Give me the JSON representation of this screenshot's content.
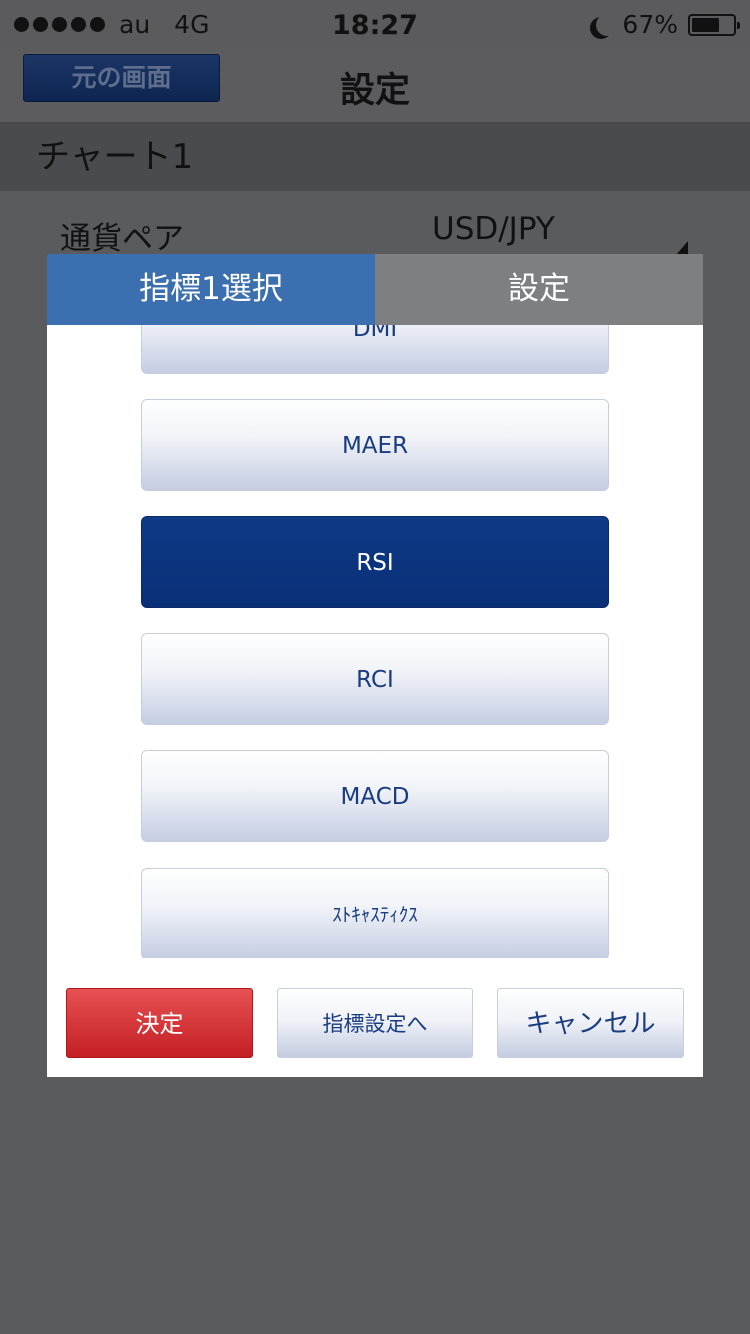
{
  "status": {
    "carrier": "au",
    "network": "4G",
    "time": "18:27",
    "battery_text": "67%",
    "battery_level": 0.67
  },
  "nav": {
    "back_label": "元の画面",
    "title": "設定"
  },
  "background": {
    "section_title": "チャート1",
    "pair_label": "通貨ペア",
    "pair_value": "USD/JPY"
  },
  "dialog": {
    "tabs": [
      {
        "label": "指標1選択",
        "active": true
      },
      {
        "label": "設定",
        "active": false
      }
    ],
    "options": [
      {
        "label": "DMI",
        "selected": false
      },
      {
        "label": "MAER",
        "selected": false
      },
      {
        "label": "RSI",
        "selected": true
      },
      {
        "label": "RCI",
        "selected": false
      },
      {
        "label": "MACD",
        "selected": false
      },
      {
        "label": "ｽﾄｷｬｽﾃｨｸｽ",
        "selected": false
      }
    ],
    "buttons": {
      "confirm": "決定",
      "indicator_settings": "指標設定へ",
      "cancel": "キャンセル"
    }
  },
  "colors": {
    "tab_active": "#3b6faf",
    "tab_inactive": "#7e7f80",
    "selected_option": "#0e3a86",
    "confirm_button": "#d6383b",
    "option_text": "#1a3c80"
  }
}
